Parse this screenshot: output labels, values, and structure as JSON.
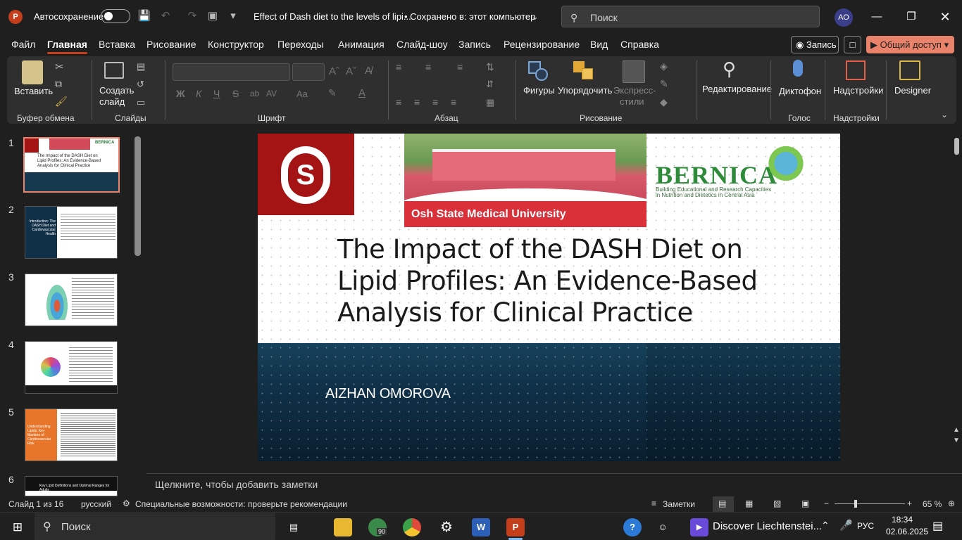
{
  "app": {
    "logo": "P",
    "autosave_label": "Автосохранение",
    "doc_title": "Effect of Dash diet to the levels of lipi...",
    "save_status": "• Сохранено в: этот компьютер",
    "search_placeholder": "Поиск",
    "user_initials": "АО"
  },
  "menu": {
    "items": [
      "Файл",
      "Главная",
      "Вставка",
      "Рисование",
      "Конструктор",
      "Переходы",
      "Анимация",
      "Слайд-шоу",
      "Запись",
      "Рецензирование",
      "Вид",
      "Справка"
    ],
    "record_label": "Запись",
    "share_label": "Общий доступ"
  },
  "ribbon": {
    "paste": "Вставить",
    "new_slide_1": "Создать",
    "new_slide_2": "слайд",
    "shapes": "Фигуры",
    "arrange": "Упорядочить",
    "quick_styles_1": "Экспресс-",
    "quick_styles_2": "стили",
    "editing": "Редактирование",
    "dictate": "Диктофон",
    "addins": "Надстройки",
    "designer": "Designer",
    "groups": {
      "clipboard": "Буфер обмена",
      "slides": "Слайды",
      "font": "Шрифт",
      "paragraph": "Абзац",
      "drawing": "Рисование",
      "voice": "Голос",
      "addins": "Надстройки"
    },
    "font_buttons": [
      "Ж",
      "К",
      "Ч",
      "S"
    ]
  },
  "thumbnails": [
    {
      "num": "1",
      "title": "The Impact of the DASH Diet on Lipid Profiles: An Evidence-Based Analysis for Clinical Practice"
    },
    {
      "num": "2",
      "title": "Introduction: The DASH Diet and Cardiovascular Health"
    },
    {
      "num": "3",
      "title": ""
    },
    {
      "num": "4",
      "title": ""
    },
    {
      "num": "5",
      "title": "Understanding Lipids: Key Markers of Cardiovascular Risk"
    },
    {
      "num": "6",
      "title": "Key Lipid Definitions and Optimal Ranges for Adults"
    }
  ],
  "slide": {
    "university": "Osh State Medical University",
    "brand": "BERNICA",
    "brand_tagline_1": "Building Educational and Research Capacities",
    "brand_tagline_2": "in Nutrition and Dietetics in Central Asia",
    "title": "The Impact of the DASH Diet on Lipid Profiles: An Evidence-Based Analysis for Clinical Practice",
    "author": "AIZHAN OMOROVA"
  },
  "notes_placeholder": "Щелкните, чтобы добавить заметки",
  "status": {
    "slide_counter": "Слайд 1 из 16",
    "language": "русский",
    "accessibility": "Специальные возможности: проверьте рекомендации",
    "notes": "Заметки",
    "zoom": "65 %"
  },
  "taskbar": {
    "search": "Поиск",
    "chrome_badge": "90",
    "news": "Discover Liechtenstei...",
    "lang": "РУС",
    "time": "18:34",
    "date": "02.06.2025"
  },
  "colors": {
    "accent": "#c43e1c",
    "share": "#e8826a",
    "slide_red": "#a51414",
    "slide_teal": "#16415a"
  }
}
